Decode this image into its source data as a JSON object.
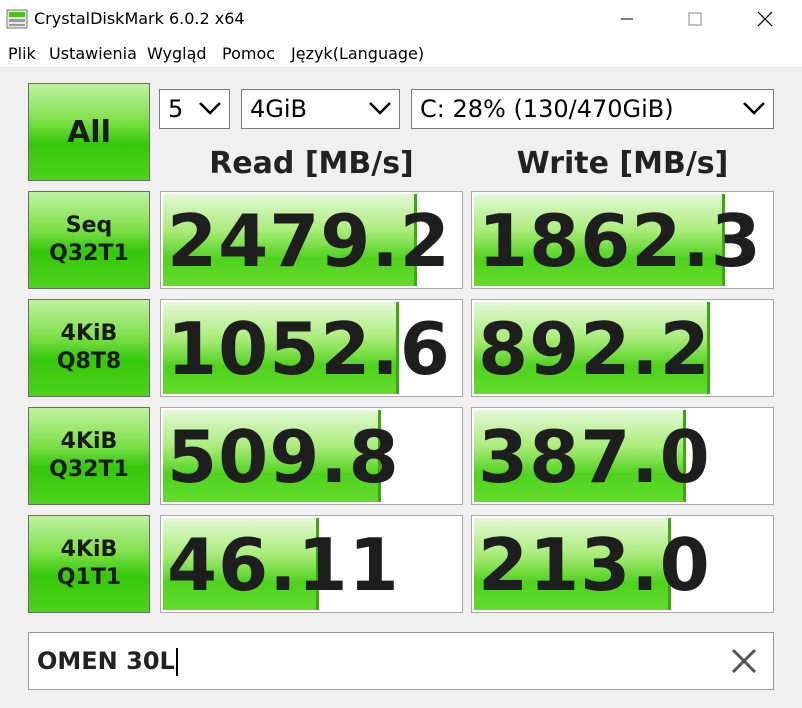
{
  "window": {
    "title": "CrystalDiskMark 6.0.2 x64",
    "icon": "app-icon"
  },
  "menu": {
    "items": [
      {
        "label": "Plik"
      },
      {
        "label": "Ustawienia"
      },
      {
        "label": "Wygląd"
      },
      {
        "label": "Pomoc"
      },
      {
        "label": "Język(Language)"
      }
    ]
  },
  "controls": {
    "all_label": "All",
    "count_value": "5",
    "size_value": "4GiB",
    "drive_value": "C: 28% (130/470GiB)"
  },
  "headers": {
    "read": "Read [MB/s]",
    "write": "Write [MB/s]"
  },
  "tests": [
    {
      "line1": "Seq",
      "line2": "Q32T1",
      "read": "2479.2",
      "write": "1862.3",
      "read_fill": 0.85,
      "write_fill": 0.84
    },
    {
      "line1": "4KiB",
      "line2": "Q8T8",
      "read": "1052.6",
      "write": "892.2",
      "read_fill": 0.79,
      "write_fill": 0.79
    },
    {
      "line1": "4KiB",
      "line2": "Q32T1",
      "read": "509.8",
      "write": "387.0",
      "read_fill": 0.73,
      "write_fill": 0.71
    },
    {
      "line1": "4KiB",
      "line2": "Q1T1",
      "read": "46.11",
      "write": "213.0",
      "read_fill": 0.52,
      "write_fill": 0.66
    }
  ],
  "comment": {
    "value": "OMEN 30L"
  },
  "colors": {
    "bar_green": "#4fd21e",
    "button_green": "#35c80a"
  }
}
